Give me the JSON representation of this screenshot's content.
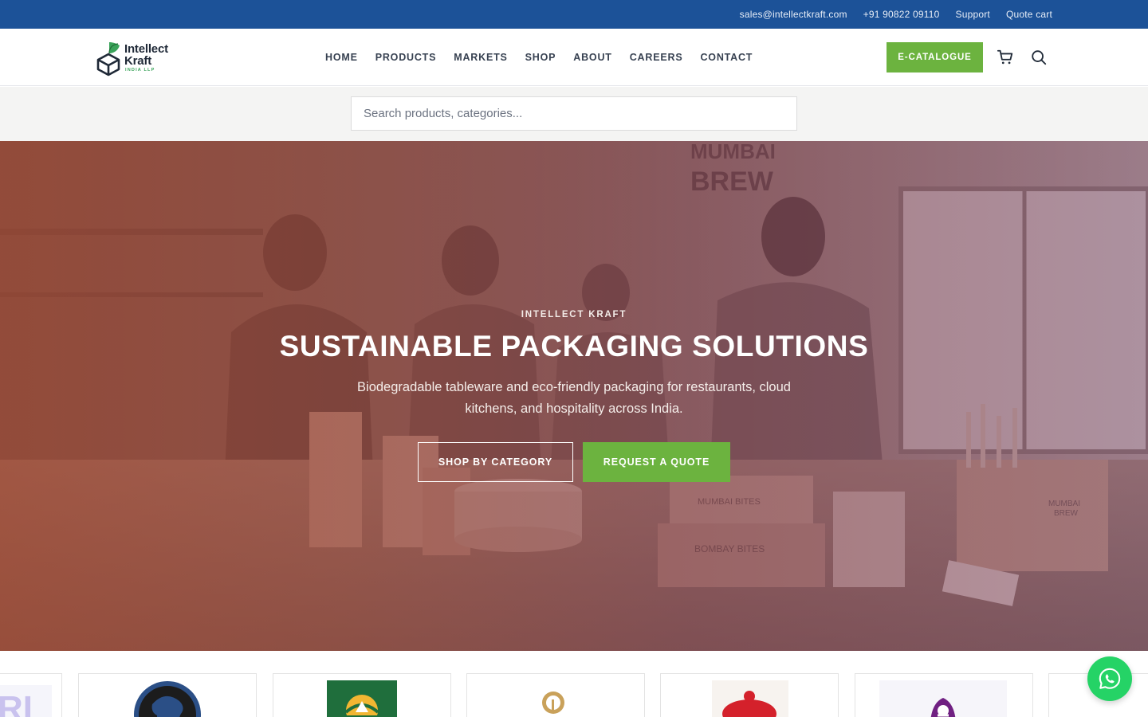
{
  "topbar": {
    "email": "sales@intellectkraft.com",
    "phone": "+91 90822 09110",
    "support": "Support",
    "quote_cart": "Quote cart"
  },
  "brand": {
    "line1": "Intellect",
    "line2": "Kraft",
    "line3": "INDIA LLP",
    "logo_icon": "box-with-leaf-icon",
    "green": "#3aa35a"
  },
  "nav": {
    "items": [
      "HOME",
      "PRODUCTS",
      "MARKETS",
      "SHOP",
      "ABOUT",
      "CAREERS",
      "CONTACT"
    ]
  },
  "header": {
    "ecatalogue_label": "E-CATALOGUE",
    "cart_icon": "cart-icon",
    "search_icon": "search-icon"
  },
  "search": {
    "placeholder": "Search products, categories..."
  },
  "hero": {
    "eyebrow": "INTELLECT KRAFT",
    "title": "SUSTAINABLE PACKAGING SOLUTIONS",
    "subtitle": "Biodegradable tableware and eco-friendly packaging for restaurants, cloud kitchens, and hospitality across India.",
    "btn_shop": "SHOP BY CATEGORY",
    "btn_quote": "REQUEST A QUOTE",
    "photo_signs": [
      "MUMBAI",
      "BREW",
      "MUMBAI BITES",
      "BOMBAY BITES",
      "MUMBAI BREW"
    ]
  },
  "clients": {
    "logos": [
      "client-logo-partial",
      "client-logo-elephant",
      "client-logo-trunkobrt",
      "client-logo-reliance",
      "client-logo-haldirams",
      "client-logo-taco-bell",
      "client-logo-partial"
    ]
  },
  "colors": {
    "topbar": "#1c5298",
    "accent_green": "#6cb33f",
    "whatsapp": "#25d366"
  },
  "whatsapp_icon": "whatsapp-icon"
}
